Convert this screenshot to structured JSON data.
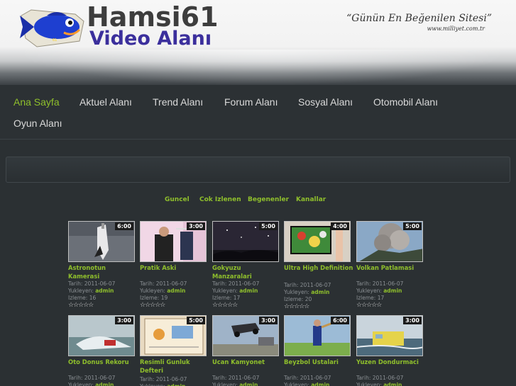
{
  "header": {
    "logo_title": "Hamsi61",
    "logo_subtitle": "Video Alanı",
    "tagline": "“Günün En Beğenilen Sitesi”",
    "tagline_site": "www.milliyet.com.tr",
    "colors": {
      "title": "#3d3d3d",
      "subtitle": "#3b2f9c",
      "fish": "#1e3fd0"
    }
  },
  "nav": {
    "items": [
      {
        "label": "Ana Sayfa",
        "active": true
      },
      {
        "label": "Aktuel Alanı",
        "active": false
      },
      {
        "label": "Trend Alanı",
        "active": false
      },
      {
        "label": "Forum Alanı",
        "active": false
      },
      {
        "label": "Sosyal Alanı",
        "active": false
      },
      {
        "label": "Otomobil Alanı",
        "active": false
      },
      {
        "label": "Oyun Alanı",
        "active": false
      }
    ],
    "accent": "#8fbf2c"
  },
  "tabs": [
    "Guncel",
    "Cok Izlenen",
    "Begenenler",
    "Kanallar"
  ],
  "labels": {
    "date_prefix": "Tarih: ",
    "uploader_prefix": "Yukleyen: ",
    "views_prefix": "Izleme: ",
    "stars": "☆☆☆☆☆"
  },
  "videos": [
    {
      "title": "Astronotun Kamerasi",
      "duration": "6:00",
      "date": "2011-06-07",
      "uploader": "admin",
      "views": "16",
      "thumb": "space-shuttle"
    },
    {
      "title": "Pratik Aski",
      "duration": "3:00",
      "date": "2011-06-07",
      "uploader": "admin",
      "views": "19",
      "thumb": "man-hanger"
    },
    {
      "title": "Gokyuzu Manzaralari",
      "duration": "5:00",
      "date": "2011-06-07",
      "uploader": "admin",
      "views": "17",
      "thumb": "night-sky"
    },
    {
      "title": "Ultra High Definition",
      "duration": "4:00",
      "date": "2011-06-07",
      "uploader": "admin",
      "views": "20",
      "thumb": "tv-screen"
    },
    {
      "title": "Volkan Patlamasi",
      "duration": "5:00",
      "date": "2011-06-07",
      "uploader": "admin",
      "views": "17",
      "thumb": "volcano"
    },
    {
      "title": "Oto Donus Rekoru",
      "duration": "3:00",
      "date": "2011-06-07",
      "uploader": "admin",
      "views": "",
      "thumb": "car-water"
    },
    {
      "title": "Resimli Gunluk Defteri",
      "duration": "5:00",
      "date": "2011-06-07",
      "uploader": "admin",
      "views": "",
      "thumb": "notebook"
    },
    {
      "title": "Ucan Kamyonet",
      "duration": "3:00",
      "date": "2011-06-07",
      "uploader": "admin",
      "views": "",
      "thumb": "flying-truck"
    },
    {
      "title": "Beyzbol Ustalari",
      "duration": "6:00",
      "date": "2011-06-07",
      "uploader": "admin",
      "views": "",
      "thumb": "baseball"
    },
    {
      "title": "Yuzen Dondurmaci",
      "duration": "3:00",
      "date": "2011-06-07",
      "uploader": "admin",
      "views": "",
      "thumb": "floating-van"
    }
  ]
}
